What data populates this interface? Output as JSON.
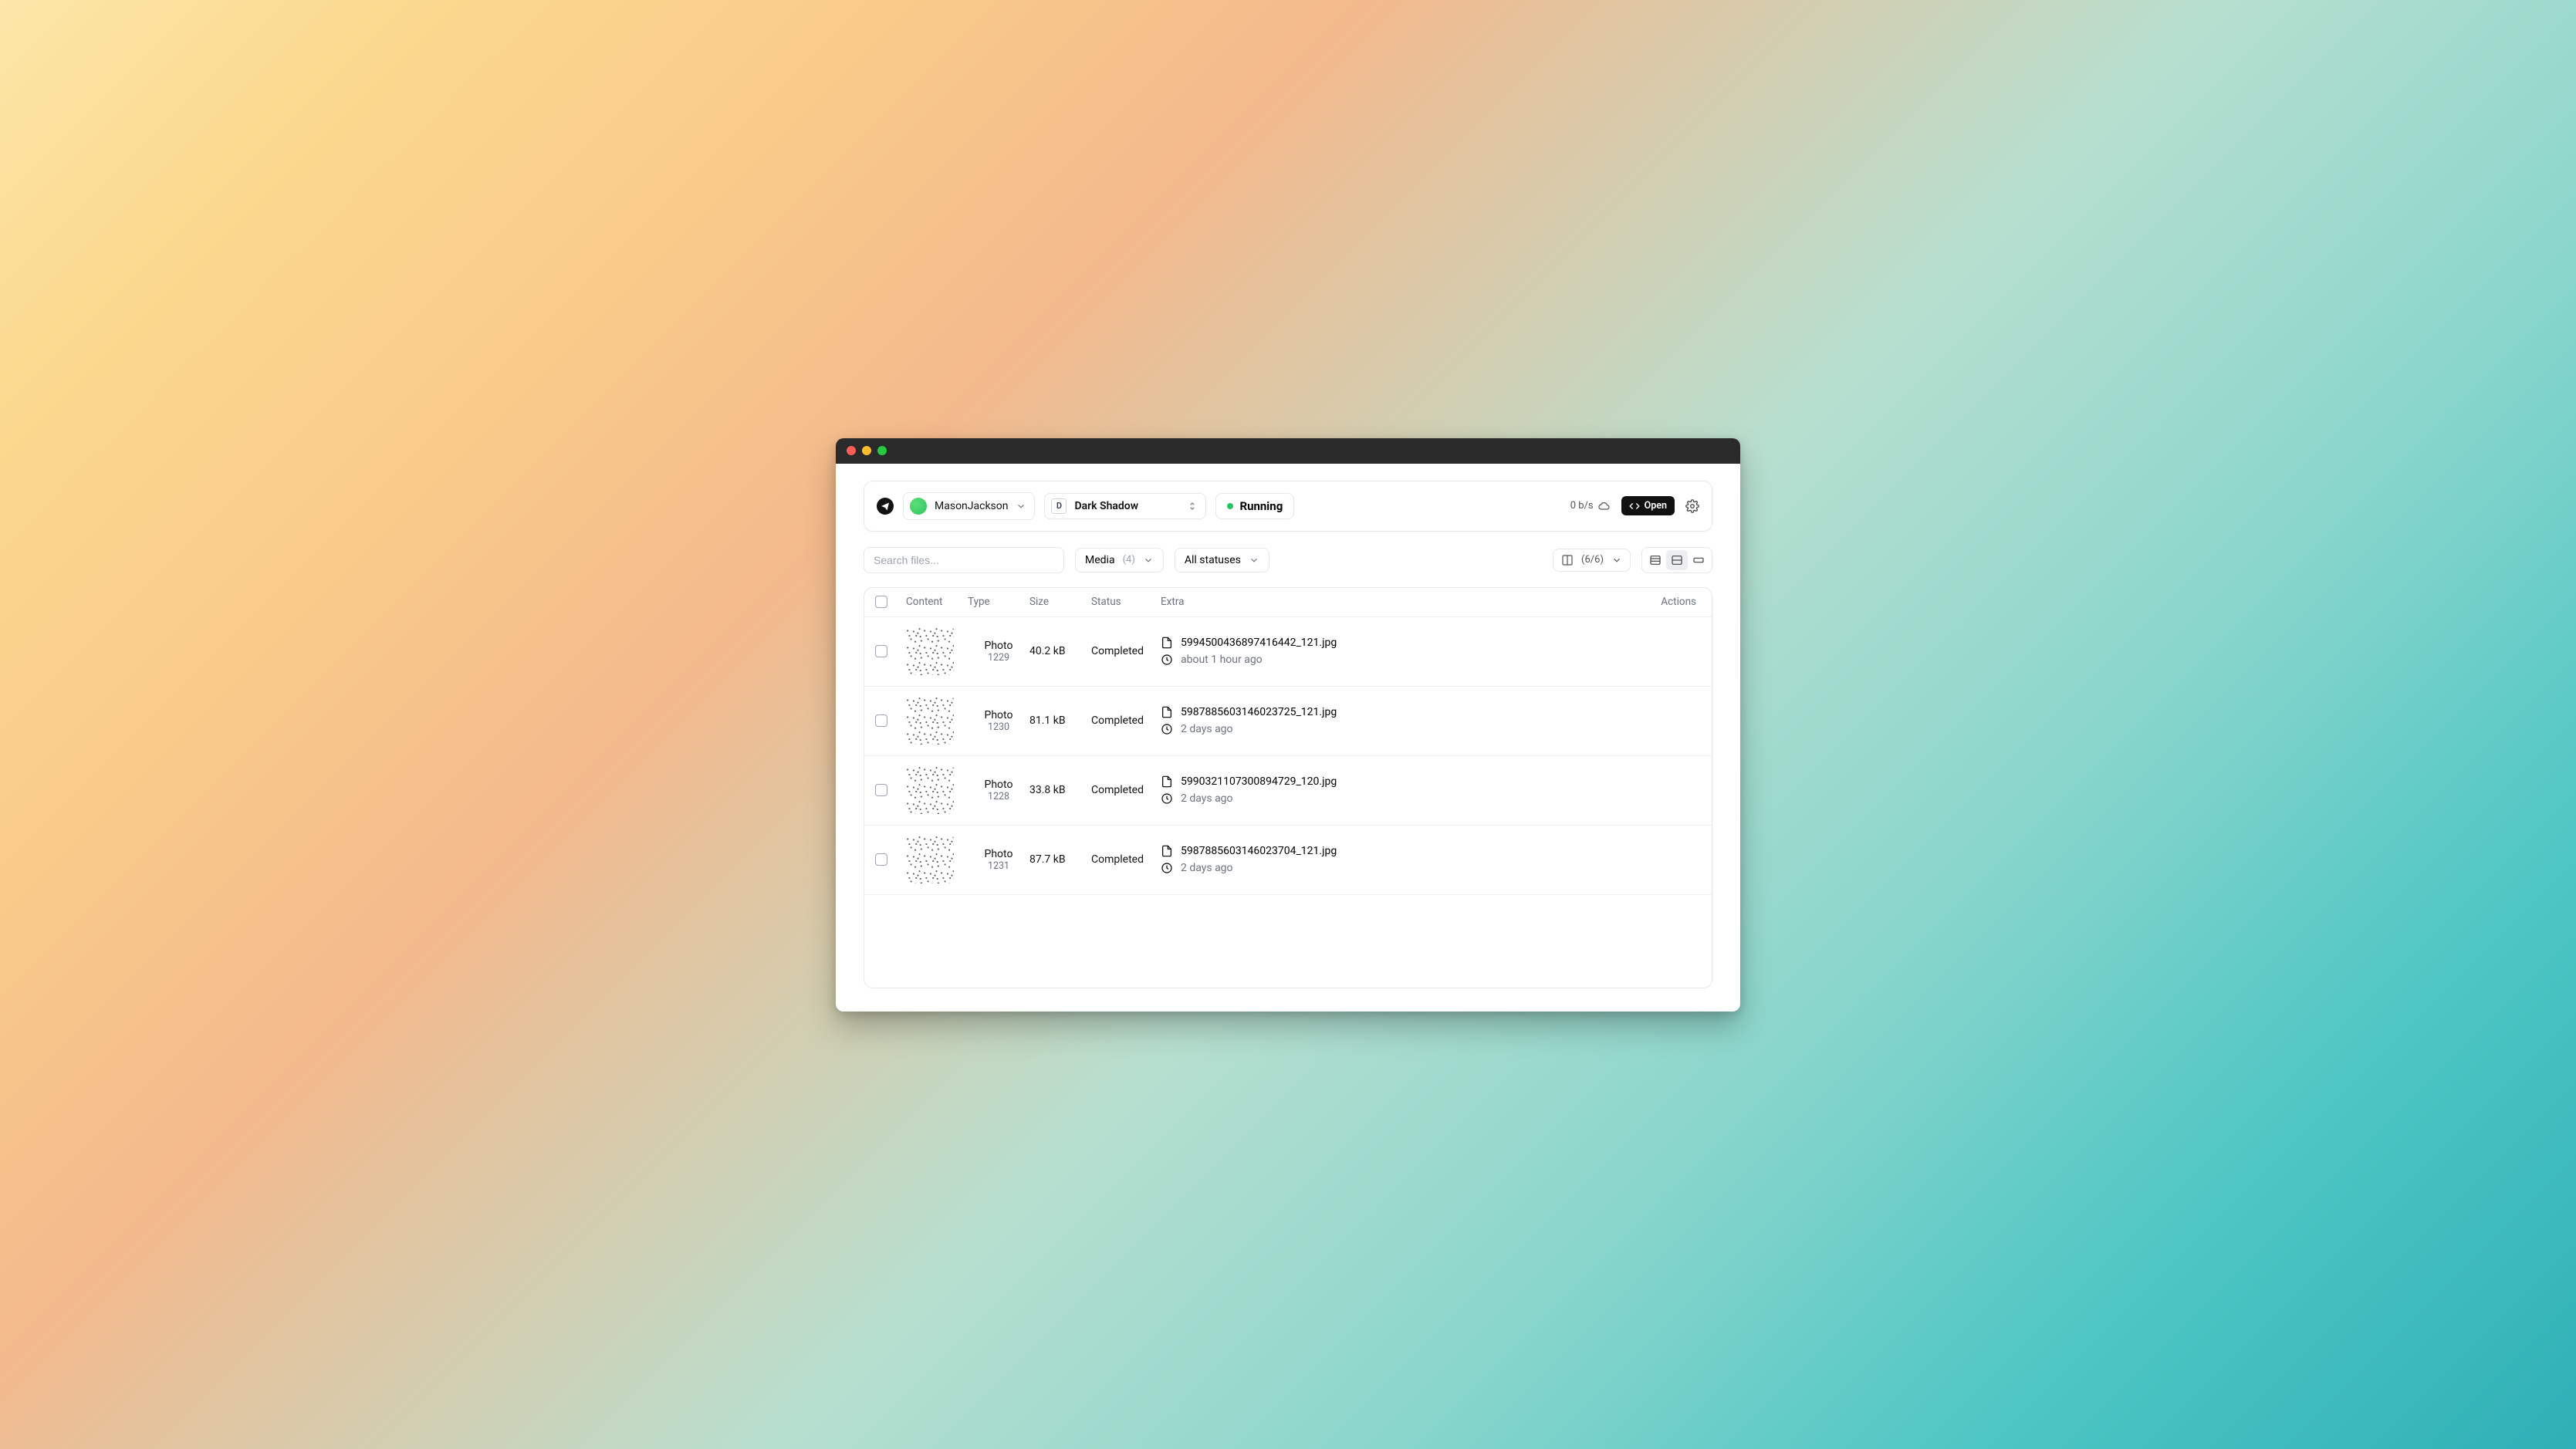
{
  "header": {
    "account_name": "MasonJackson",
    "project_initial": "D",
    "project_name": "Dark Shadow",
    "status_label": "Running",
    "speed_label": "0 b/s",
    "open_button_label": "Open"
  },
  "filters": {
    "search_placeholder": "Search files...",
    "type_label": "Media",
    "type_count": "(4)",
    "status_label": "All statuses",
    "columns_count": "(6/6)"
  },
  "table": {
    "headers": {
      "content": "Content",
      "type": "Type",
      "size": "Size",
      "status": "Status",
      "extra": "Extra",
      "actions": "Actions"
    },
    "rows": [
      {
        "type_label": "Photo",
        "type_id": "1229",
        "size": "40.2 kB",
        "status": "Completed",
        "filename": "5994500436897416442_121.jpg",
        "time": "about 1 hour ago"
      },
      {
        "type_label": "Photo",
        "type_id": "1230",
        "size": "81.1 kB",
        "status": "Completed",
        "filename": "5987885603146023725_121.jpg",
        "time": "2 days ago"
      },
      {
        "type_label": "Photo",
        "type_id": "1228",
        "size": "33.8 kB",
        "status": "Completed",
        "filename": "5990321107300894729_120.jpg",
        "time": "2 days ago"
      },
      {
        "type_label": "Photo",
        "type_id": "1231",
        "size": "87.7 kB",
        "status": "Completed",
        "filename": "5987885603146023704_121.jpg",
        "time": "2 days ago"
      }
    ]
  }
}
